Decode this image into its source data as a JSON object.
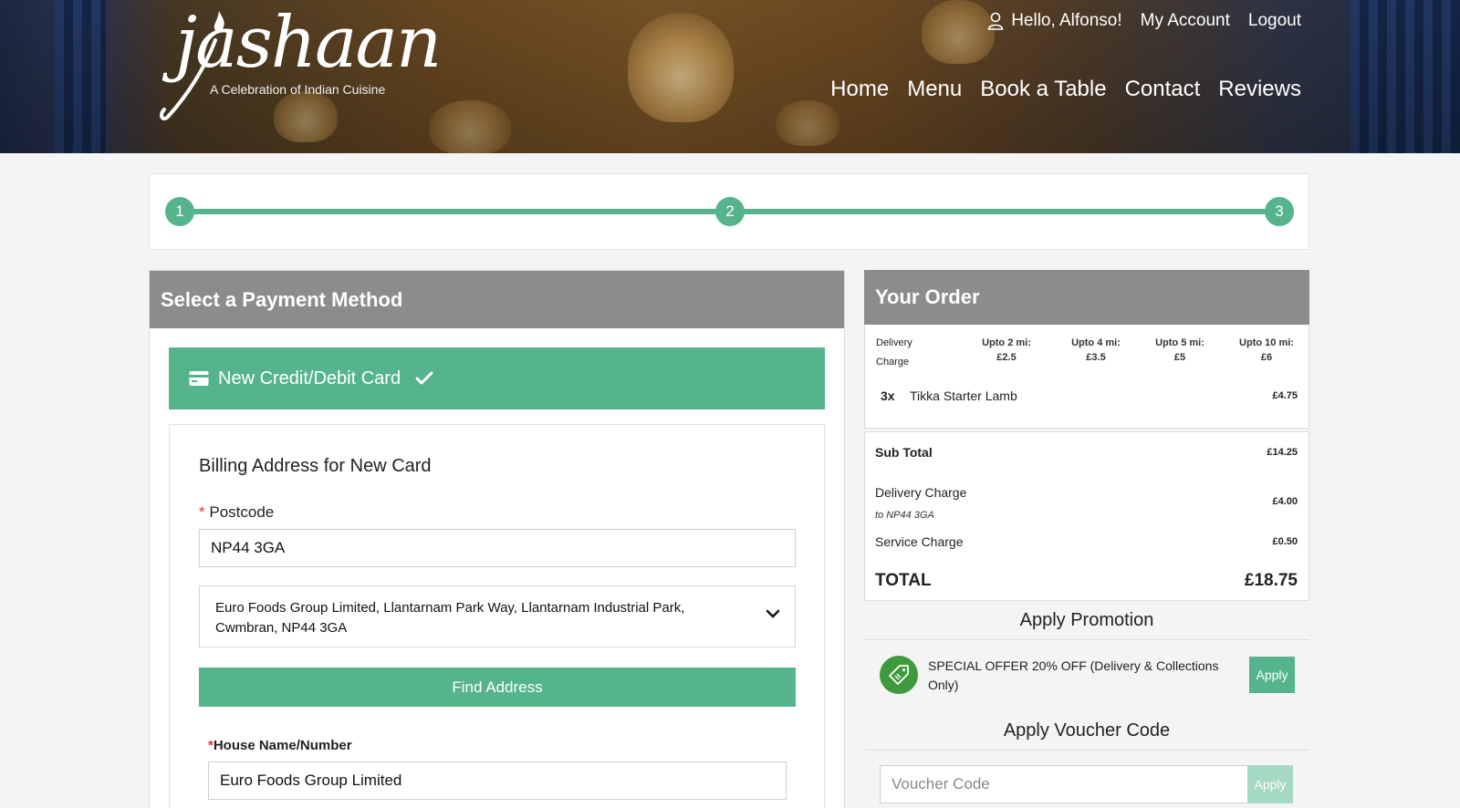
{
  "header": {
    "logo_script": "jashaan",
    "logo_tagline": "A Celebration of Indian Cuisine",
    "greeting": "Hello, Alfonso!",
    "my_account": "My Account",
    "logout": "Logout",
    "nav": [
      "Home",
      "Menu",
      "Book a Table",
      "Contact",
      "Reviews"
    ]
  },
  "stepper": {
    "steps": [
      "1",
      "2",
      "3"
    ],
    "accent": "#56b48d"
  },
  "payment": {
    "title": "Select a Payment Method",
    "method_label": "New Credit/Debit Card",
    "billing_title": "Billing Address for New Card",
    "postcode_label": "Postcode",
    "postcode_value": "NP44 3GA",
    "address_selected": "Euro Foods Group Limited, Llantarnam Park Way, Llantarnam Industrial Park, Cwmbran, NP44 3GA",
    "find_address": "Find Address",
    "house_label": "House Name/Number",
    "house_value": "Euro Foods Group Limited"
  },
  "order": {
    "title": "Your Order",
    "delivery_label_1": "Delivery",
    "delivery_label_2": "Charge",
    "tiers": [
      {
        "range": "Upto 2 mi:",
        "price": "£2.5"
      },
      {
        "range": "Upto 4 mi:",
        "price": "£3.5"
      },
      {
        "range": "Upto 5 mi:",
        "price": "£5"
      },
      {
        "range": "Upto 10 mi:",
        "price": "£6"
      }
    ],
    "items": [
      {
        "qty": "3x",
        "name": "Tikka Starter Lamb",
        "price": "£4.75"
      }
    ],
    "subtotal_label": "Sub Total",
    "subtotal_value": "£14.25",
    "delivery_charge_label": "Delivery Charge",
    "delivery_charge_note": "to NP44 3GA",
    "delivery_charge_value": "£4.00",
    "service_charge_label": "Service Charge",
    "service_charge_value": "£0.50",
    "total_label": "TOTAL",
    "total_value": "£18.75"
  },
  "promotion": {
    "title": "Apply Promotion",
    "offer_text": "SPECIAL OFFER 20% OFF (Delivery & Collections Only)",
    "apply": "Apply"
  },
  "voucher": {
    "title": "Apply Voucher Code",
    "placeholder": "Voucher Code",
    "apply": "Apply"
  }
}
